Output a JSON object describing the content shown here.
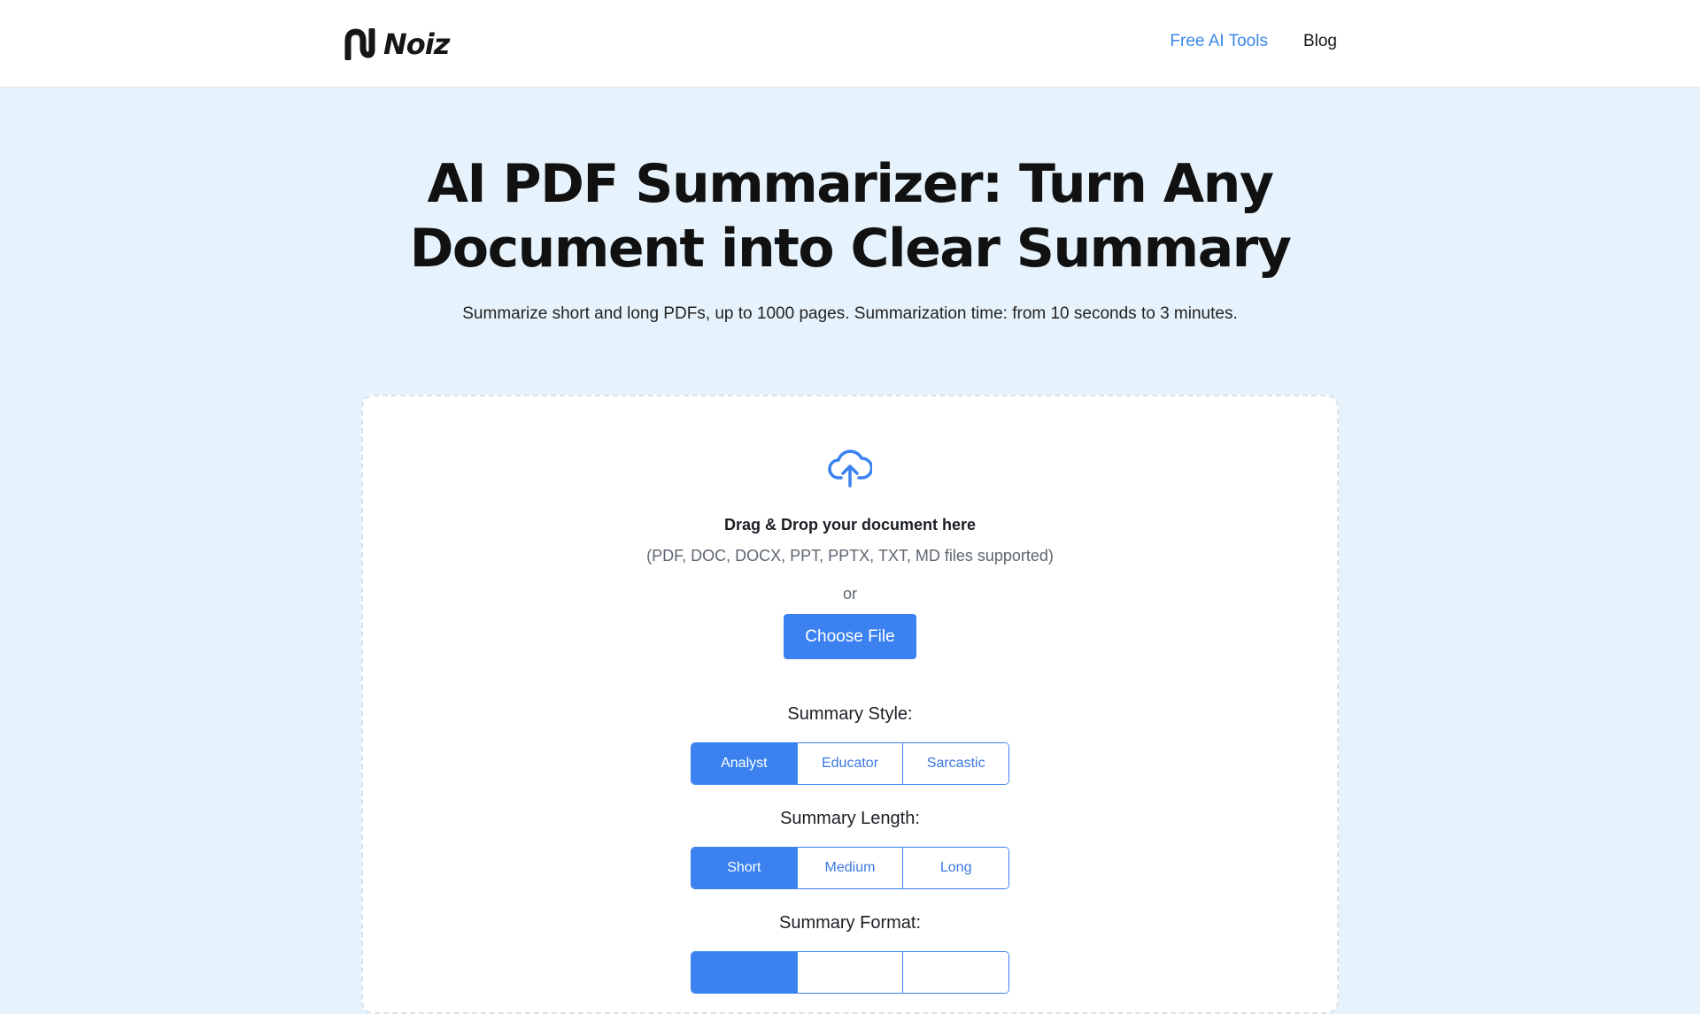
{
  "header": {
    "logo_text": "Noiz",
    "nav": [
      {
        "label": "Free AI Tools",
        "active": true
      },
      {
        "label": "Blog",
        "active": false
      }
    ]
  },
  "hero": {
    "title": "AI PDF Summarizer: Turn Any Document into Clear Summary",
    "subtitle": "Summarize short and long PDFs, up to 1000 pages. Summarization time: from 10 seconds to 3 minutes."
  },
  "upload": {
    "icon": "cloud-upload-icon",
    "title": "Drag & Drop your document here",
    "types": "(PDF, DOC, DOCX, PPT, PPTX, TXT, MD files supported)",
    "or": "or",
    "button": "Choose File"
  },
  "options": {
    "style": {
      "label": "Summary Style:",
      "choices": [
        "Analyst",
        "Educator",
        "Sarcastic"
      ],
      "selected": "Analyst"
    },
    "length": {
      "label": "Summary Length:",
      "choices": [
        "Short",
        "Medium",
        "Long"
      ],
      "selected": "Short"
    },
    "format": {
      "label": "Summary Format:"
    }
  },
  "colors": {
    "accent": "#3b82f0",
    "page_background": "#e6f3fc",
    "nav_active": "#3a87e8"
  }
}
